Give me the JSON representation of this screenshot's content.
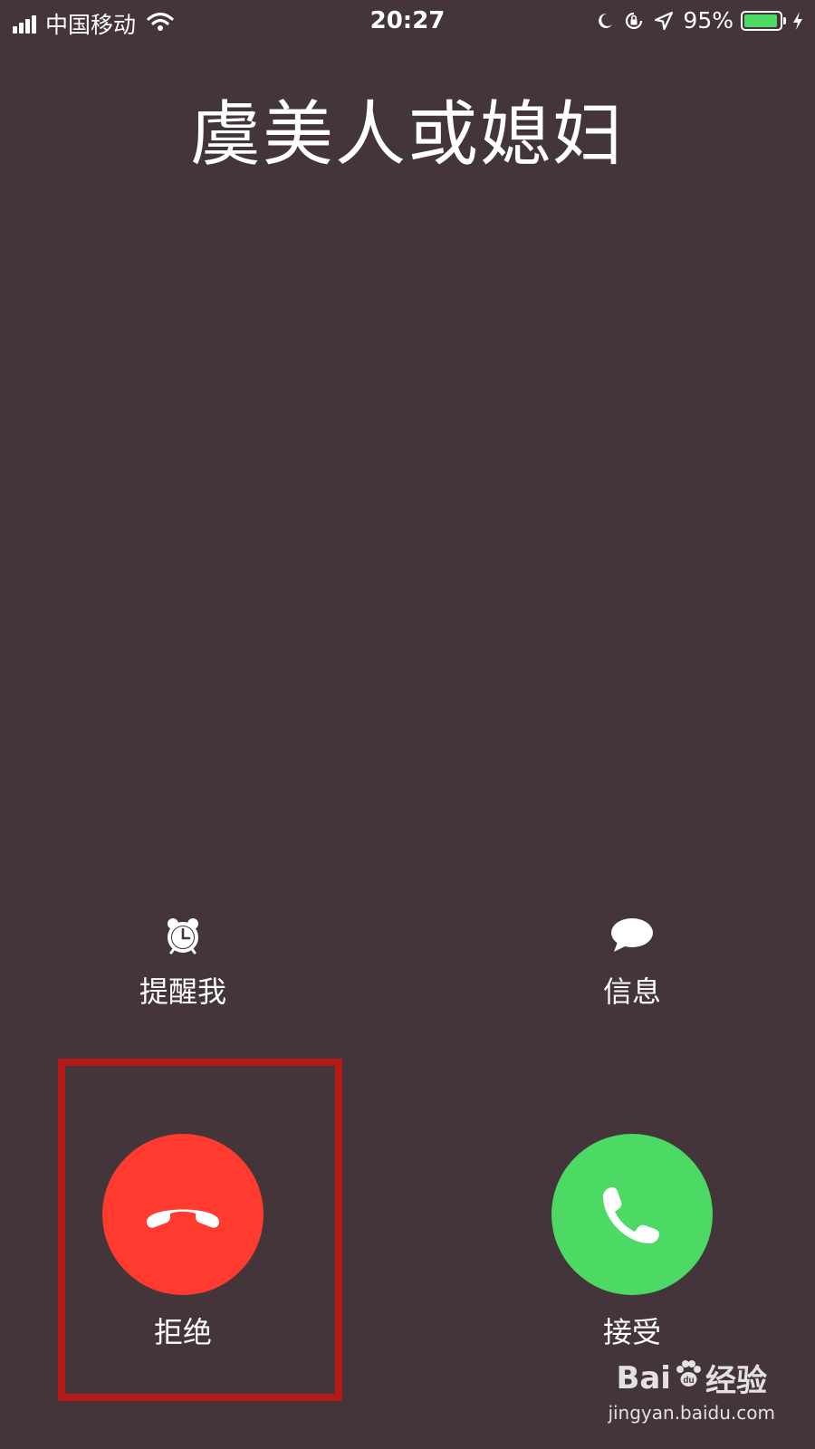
{
  "status_bar": {
    "carrier": "中国移动",
    "time": "20:27",
    "battery_percent": "95%",
    "battery_level": 0.95,
    "battery_color": "#4cd964"
  },
  "caller": {
    "name": "虞美人或媳妇"
  },
  "actions": {
    "remind_label": "提醒我",
    "remind_icon": "alarm-clock-icon",
    "message_label": "信息",
    "message_icon": "message-bubble-icon"
  },
  "buttons": {
    "decline_label": "拒绝",
    "decline_color": "#ff3b30",
    "accept_label": "接受",
    "accept_color": "#4cd964"
  },
  "highlight_color": "#b51a17",
  "watermark": {
    "brand_left": "Bai",
    "brand_right": "经验",
    "url": "jingyan.baidu.com"
  }
}
